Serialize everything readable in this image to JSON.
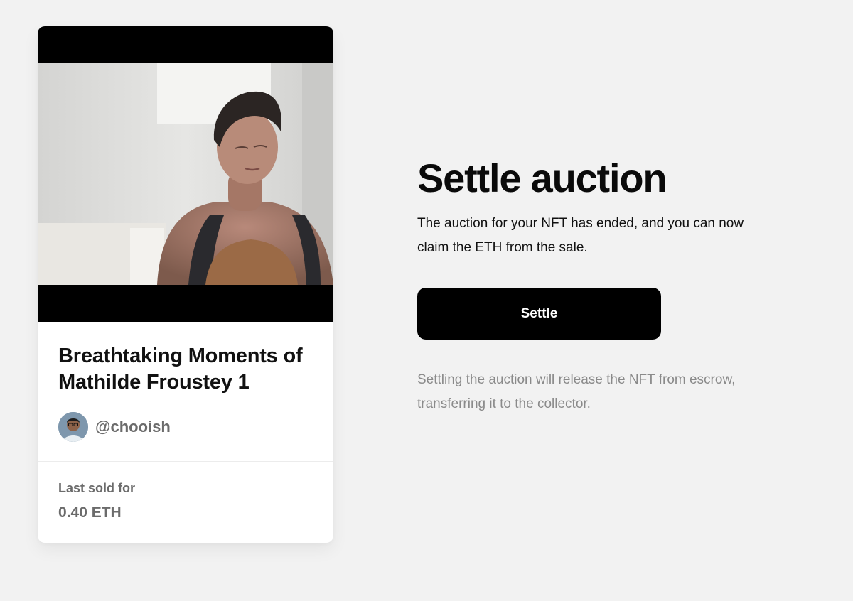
{
  "nft_card": {
    "title": "Breathtaking Moments of Mathilde Froustey 1",
    "creator_handle": "@chooish",
    "last_sold_label": "Last sold for",
    "last_sold_price": "0.40 ETH"
  },
  "settle_panel": {
    "heading": "Settle auction",
    "description": "The auction for your NFT has ended, and you can now claim the ETH from the sale.",
    "button_label": "Settle",
    "note": "Settling the auction will release the NFT from escrow, transferring it to the collector."
  },
  "colors": {
    "background": "#f2f2f2",
    "card": "#ffffff",
    "button": "#000000",
    "muted_text": "#8a8a8a"
  }
}
